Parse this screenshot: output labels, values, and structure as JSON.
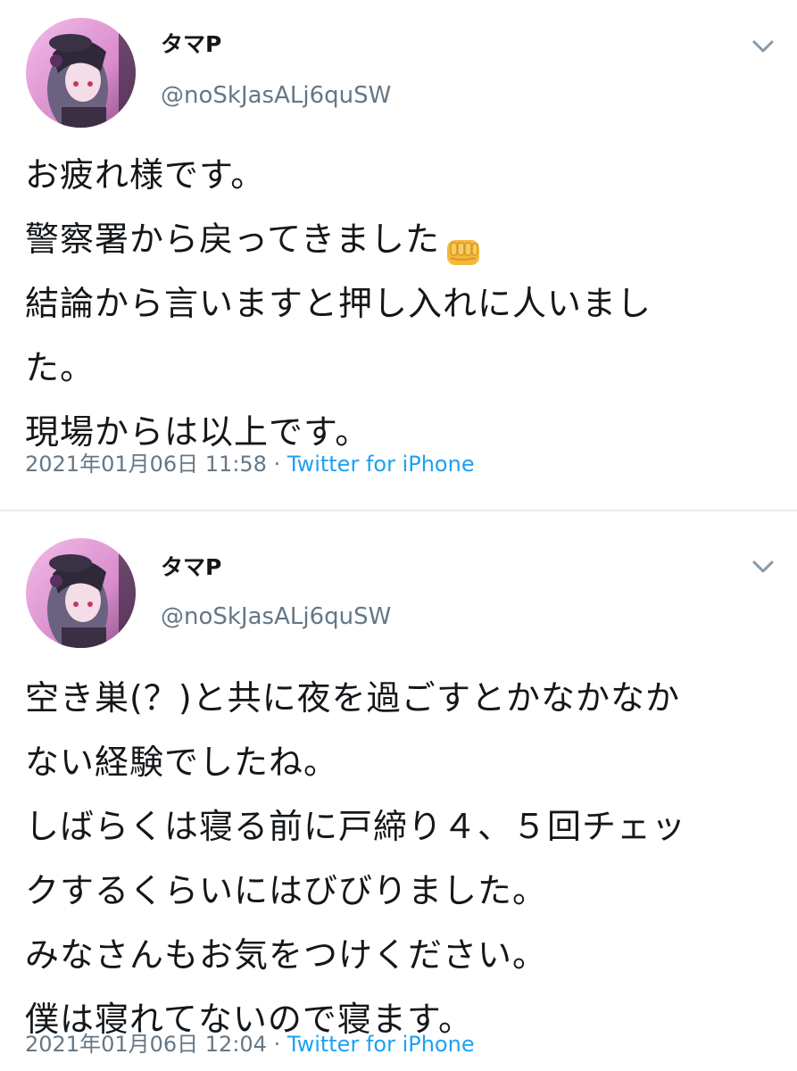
{
  "tweets": [
    {
      "user": {
        "display_name": "タマP",
        "handle": "@noSkJasALj6quSW"
      },
      "body_lines": [
        "お疲れ様です。",
        "警察署から戻ってきました",
        "結論から言いますと押し入れに人いまし",
        "た。",
        "現場からは以上です。"
      ],
      "emoji_after_line_2": "oncoming-fist-emoji",
      "timestamp": "2021年01月06日 11:58",
      "separator": "·",
      "source": "Twitter for iPhone"
    },
    {
      "user": {
        "display_name": "タマP",
        "handle": "@noSkJasALj6quSW"
      },
      "body_lines": [
        "空き巣(？)と共に夜を過ごすとかなかなか",
        "ない経験でしたね。",
        "しばらくは寝る前に戸締り４、５回チェッ",
        "クするくらいにはびびりました。",
        "みなさんもお気をつけください。",
        "僕は寝れてないので寝ます。"
      ],
      "timestamp": "2021年01月06日 12:04",
      "separator": "·",
      "source": "Twitter for iPhone"
    }
  ],
  "icons": {
    "menu": "chevron-down-icon",
    "avatar": "avatar-image"
  },
  "colors": {
    "text_primary": "#14171a",
    "text_secondary": "#657786",
    "link": "#1da1f2",
    "divider": "#e6ecf0",
    "avatar_bg": "#e9b3dd"
  }
}
